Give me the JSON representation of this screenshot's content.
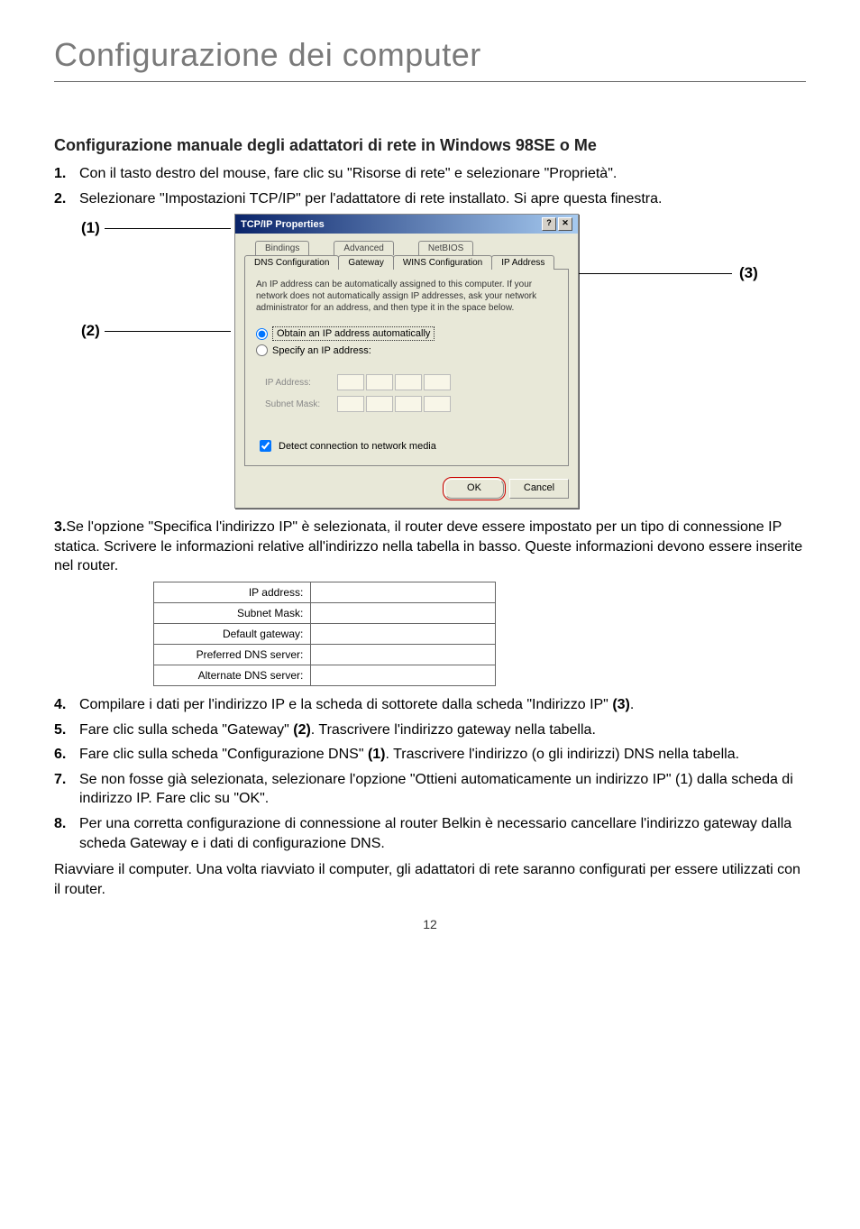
{
  "pageTitle": "Configurazione dei computer",
  "subheading": "Configurazione manuale degli adattatori di rete in Windows 98SE o Me",
  "steps12": [
    {
      "num": "1.",
      "txt": "Con il tasto destro del mouse, fare clic su \"Risorse di rete\" e selezionare \"Proprietà\"."
    },
    {
      "num": "2.",
      "txt": "Selezionare \"Impostazioni TCP/IP\" per l'adattatore di rete installato. Si apre questa finestra."
    }
  ],
  "markers": {
    "m1": "(1)",
    "m2": "(2)",
    "m3": "(3)"
  },
  "dialog": {
    "title": "TCP/IP Properties",
    "helpGlyph": "?",
    "closeGlyph": "✕",
    "tabsBack": [
      {
        "label": "Bindings"
      },
      {
        "label": "Advanced"
      },
      {
        "label": "NetBIOS"
      }
    ],
    "tabsFront": [
      {
        "label": "DNS Configuration"
      },
      {
        "label": "Gateway"
      },
      {
        "label": "WINS Configuration"
      },
      {
        "label": "IP Address"
      }
    ],
    "panelText": "An IP address can be automatically assigned to this computer. If your network does not automatically assign IP addresses, ask your network administrator for an address, and then type it in the space below.",
    "radioAuto": "Obtain an IP address automatically",
    "radioSpecify": "Specify an IP address:",
    "fieldIp": "IP Address:",
    "fieldMask": "Subnet Mask:",
    "chkDetect": "Detect connection to network media",
    "btnOk": "OK",
    "btnCancel": "Cancel"
  },
  "step3": {
    "lead": "3.",
    "text": "Se l'opzione \"Specifica l'indirizzo IP\" è selezionata, il router deve essere impostato per un tipo di connessione IP statica. Scrivere le informazioni relative all'indirizzo nella tabella in basso. Queste informazioni devono essere inserite nel router."
  },
  "ipTable": [
    "IP address:",
    "Subnet Mask:",
    "Default gateway:",
    "Preferred DNS server:",
    "Alternate DNS server:"
  ],
  "steps48": [
    {
      "num": "4.",
      "pre": "Compilare i dati per l'indirizzo IP e la scheda di sottorete dalla scheda \"Indirizzo IP\" ",
      "bold": "(3)",
      "post": "."
    },
    {
      "num": "5.",
      "pre": "Fare clic sulla scheda \"Gateway\" ",
      "bold": "(2)",
      "post": ". Trascrivere l'indirizzo gateway nella tabella."
    },
    {
      "num": "6.",
      "pre": "Fare clic sulla scheda \"Configurazione DNS\" ",
      "bold": "(1)",
      "post": ". Trascrivere l'indirizzo (o gli indirizzi) DNS nella tabella."
    },
    {
      "num": "7.",
      "pre": "Se non fosse già selezionata, selezionare l'opzione \"Ottieni automaticamente un indirizzo IP\" (1) dalla scheda di indirizzo IP. Fare clic su \"OK\".",
      "bold": "",
      "post": ""
    },
    {
      "num": "8.",
      "pre": "Per una corretta configurazione di connessione al router Belkin è necessario cancellare l'indirizzo gateway dalla scheda Gateway e i dati di configurazione DNS.",
      "bold": "",
      "post": ""
    }
  ],
  "closing": "Riavviare il computer. Una volta riavviato il computer, gli adattatori di rete saranno configurati per essere utilizzati con il router.",
  "pageNum": "12"
}
